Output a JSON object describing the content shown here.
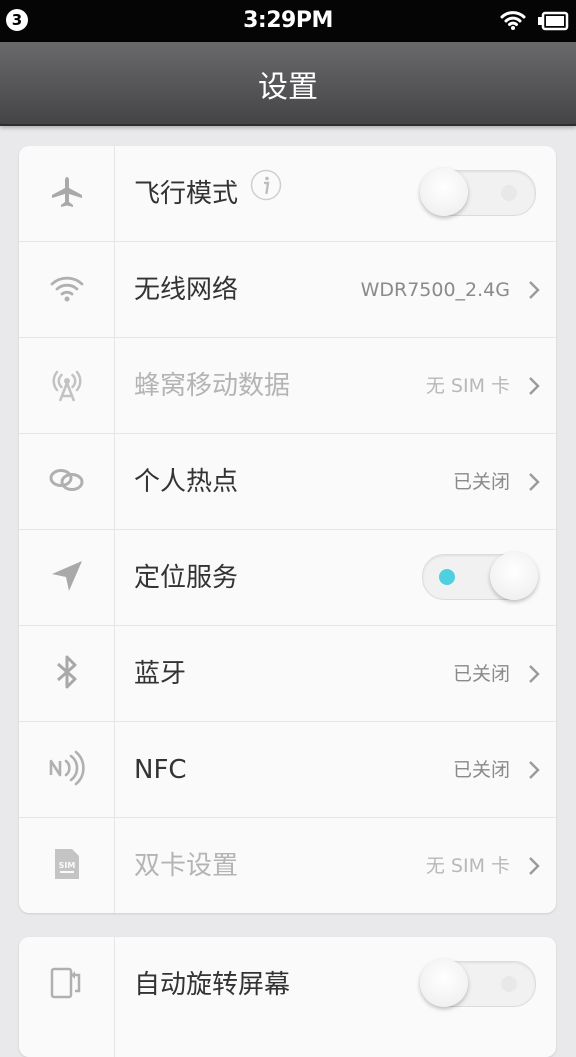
{
  "status_bar": {
    "notification_count": "3",
    "time": "3:29PM"
  },
  "header": {
    "title": "设置"
  },
  "settings": [
    {
      "label": "飞行模式",
      "toggle": "off",
      "icon": "airplane-icon",
      "info": true
    },
    {
      "label": "无线网络",
      "value": "WDR7500_2.4G",
      "icon": "wifi-icon"
    },
    {
      "label": "蜂窝移动数据",
      "value": "无 SIM 卡",
      "icon": "cellular-antenna-icon",
      "disabled": true
    },
    {
      "label": "个人热点",
      "value": "已关闭",
      "icon": "hotspot-link-icon"
    },
    {
      "label": "定位服务",
      "toggle": "on",
      "icon": "location-arrow-icon"
    },
    {
      "label": "蓝牙",
      "value": "已关闭",
      "icon": "bluetooth-icon"
    },
    {
      "label": "NFC",
      "value": "已关闭",
      "icon": "nfc-icon"
    },
    {
      "label": "双卡设置",
      "value": "无 SIM 卡",
      "icon": "sim-card-icon",
      "disabled": true
    }
  ],
  "settings2": [
    {
      "label": "自动旋转屏幕",
      "toggle": "off",
      "icon": "screen-rotate-icon"
    }
  ],
  "colors": {
    "title_bar": "#555557",
    "toggle_on_dot": "#4fd0e0",
    "background": "#e9e9ec"
  }
}
